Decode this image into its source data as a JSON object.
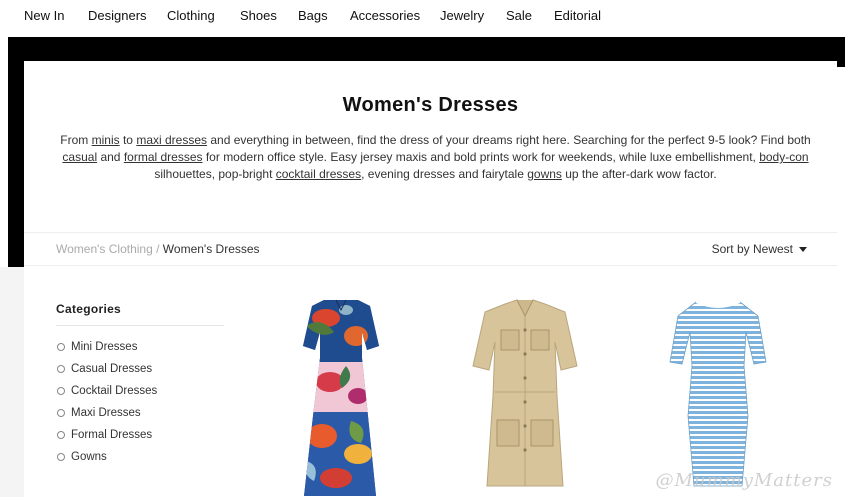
{
  "nav": {
    "items": [
      "New In",
      "Designers",
      "Clothing",
      "Shoes",
      "Bags",
      "Accessories",
      "Jewelry",
      "Sale",
      "Editorial"
    ]
  },
  "hero": {
    "title": "Women's Dresses",
    "intro": {
      "t1": "From ",
      "l1": "minis",
      "t2": " to ",
      "l2": "maxi dresses",
      "t3": " and everything in between, find the dress of your dreams right here. Searching for the perfect 9-5 look? Find both ",
      "l3": "casual",
      "t4": " and ",
      "l4": "formal dresses",
      "t5": " for modern office style. Easy jersey maxis and bold prints work for weekends, while luxe embellishment, ",
      "l5": "body-con",
      "t6": " silhouettes, pop-bright ",
      "l6": "cocktail dresses",
      "t7": ", evening dresses and fairytale ",
      "l7": "gowns",
      "t8": " up the after-dark wow factor."
    }
  },
  "breadcrumb": {
    "parent": "Women's Clothing",
    "separator": " / ",
    "current": "Women's Dresses"
  },
  "sort": {
    "label": "Sort by Newest"
  },
  "categories": {
    "heading": "Categories",
    "items": [
      "Mini Dresses",
      "Casual Dresses",
      "Cocktail Dresses",
      "Maxi Dresses",
      "Formal Dresses",
      "Gowns"
    ]
  },
  "products": [
    {
      "image": "floral-print-maxi-dress",
      "colors": [
        "#2a4f9a",
        "#d9452f",
        "#f1c7d6",
        "#5a7a3a"
      ]
    },
    {
      "image": "khaki-utility-shirt-dress",
      "colors": [
        "#d8c49a"
      ]
    },
    {
      "image": "blue-white-striped-bodycon-dress",
      "colors": [
        "#7db3dc",
        "#ffffff"
      ]
    }
  ],
  "watermark": "@MummyMatters"
}
